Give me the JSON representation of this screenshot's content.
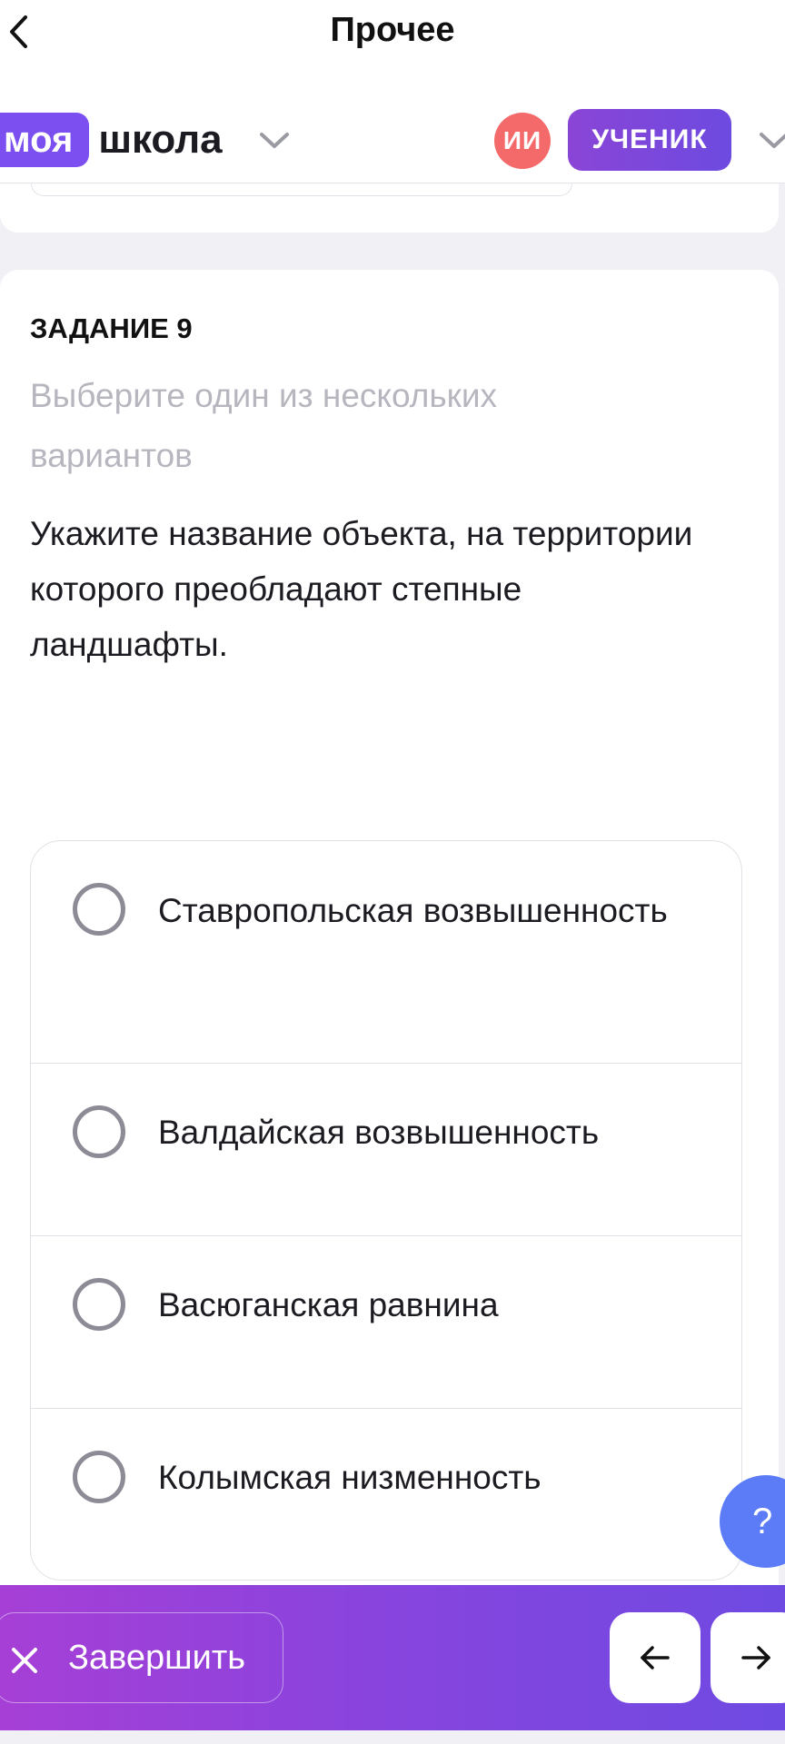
{
  "nav": {
    "title": "Прочее",
    "back_icon": "chevron-left-icon"
  },
  "header": {
    "logo_part1": "моя",
    "logo_part2": "школа",
    "ai_badge": "ИИ",
    "role": "УЧЕНИК",
    "chevron_icon": "chevron-down-icon"
  },
  "task": {
    "label": "ЗАДАНИЕ 9",
    "hint": "Выберите один из нескольких вариантов",
    "question": "Укажите название объекта, на территории которого преобладают степные ландшафты.",
    "options": [
      {
        "label": "Ставропольская возвышенность",
        "selected": false
      },
      {
        "label": "Валдайская возвышенность",
        "selected": false
      },
      {
        "label": "Васюганская равнина",
        "selected": false
      },
      {
        "label": "Колымская низменность",
        "selected": false
      }
    ]
  },
  "help": {
    "label": "?"
  },
  "footer": {
    "finish_label": "Завершить",
    "finish_icon": "close-icon",
    "prev_icon": "arrow-left-icon",
    "next_icon": "arrow-right-icon"
  },
  "colors": {
    "accent": "#7c4ff1",
    "ai_badge": "#f46a6a",
    "help_fab": "#5b7cf6",
    "bar_start": "#a63fd6",
    "bar_end": "#6e4ae2"
  }
}
